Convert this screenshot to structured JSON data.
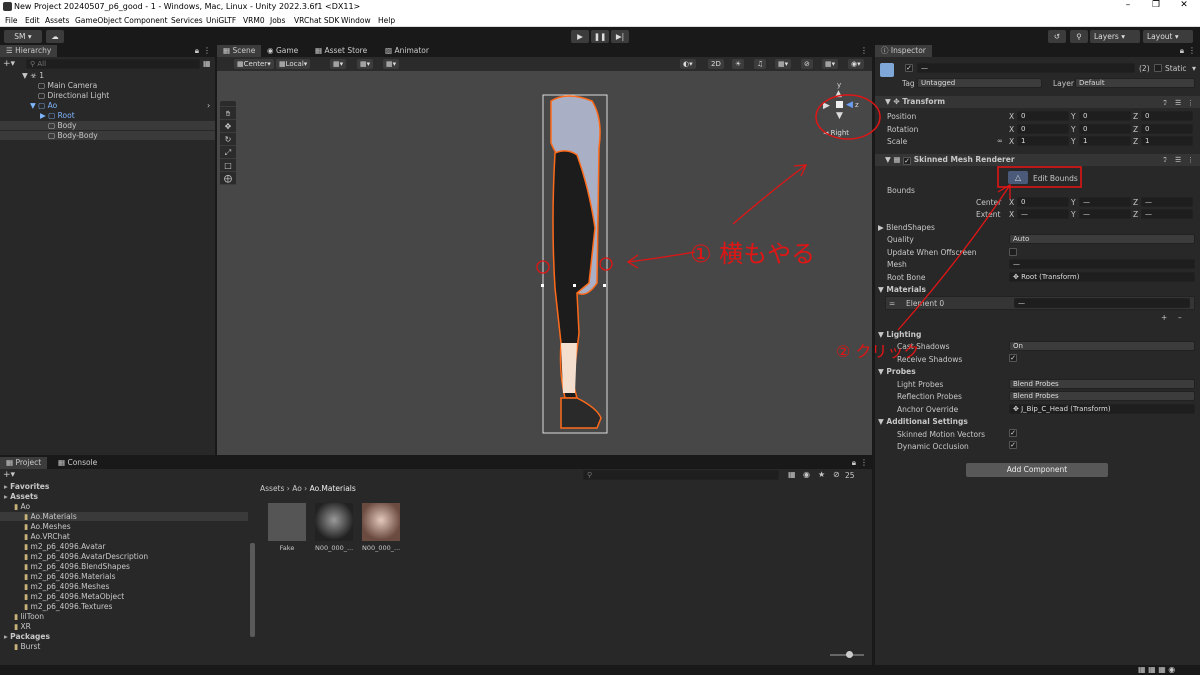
{
  "window": {
    "title": "New Project 20240507_p6_good - 1 - Windows, Mac, Linux - Unity 2022.3.6f1 <DX11>"
  },
  "menu": [
    "File",
    "Edit",
    "Assets",
    "GameObject",
    "Component",
    "Services",
    "UniGLTF",
    "VRM0",
    "Jobs",
    "VRChat SDK",
    "Window",
    "Help"
  ],
  "toolbar": {
    "account": "SM",
    "layers": "Layers",
    "layout": "Layout"
  },
  "hierarchy": {
    "tab": "Hierarchy",
    "search_placeholder": "All",
    "items": [
      "1",
      "Main Camera",
      "Directional Light",
      "Ao",
      "Root",
      "Body",
      "Body-Body"
    ]
  },
  "scene": {
    "tabs": [
      "Scene",
      "Game",
      "Asset Store",
      "Animator"
    ],
    "pivot": "Center",
    "space": "Local",
    "mode2d": "2D",
    "gizmo_label": "Right",
    "axis_y": "y",
    "axis_z": "z"
  },
  "annotations": {
    "note1": "① 横もやる",
    "note2": "② クリック"
  },
  "inspector": {
    "tab": "Inspector",
    "object_count": "(2)",
    "static_label": "Static",
    "tag_label": "Tag",
    "tag_value": "Untagged",
    "layer_label": "Layer",
    "layer_value": "Default",
    "transform": {
      "title": "Transform",
      "position": "Position",
      "rotation": "Rotation",
      "scale": "Scale",
      "pos": [
        "0",
        "0",
        "0"
      ],
      "rot": [
        "0",
        "0",
        "0"
      ],
      "scl": [
        "1",
        "1",
        "1"
      ]
    },
    "smr": {
      "title": "Skinned Mesh Renderer",
      "edit_bounds": "Edit Bounds",
      "bounds": "Bounds",
      "center": "Center",
      "extent": "Extent",
      "center_vals": [
        "0",
        "—",
        "—"
      ],
      "extent_vals": [
        "—",
        "—",
        "—"
      ],
      "blendshapes": "BlendShapes",
      "quality": "Quality",
      "quality_value": "Auto",
      "update_offscreen": "Update When Offscreen",
      "mesh": "Mesh",
      "mesh_value": "—",
      "root_bone": "Root Bone",
      "root_bone_value": "Root (Transform)",
      "materials": "Materials",
      "element0": "Element 0",
      "element0_value": "—",
      "lighting": "Lighting",
      "cast_shadows": "Cast Shadows",
      "cast_shadows_value": "On",
      "receive_shadows": "Receive Shadows",
      "probes": "Probes",
      "light_probes": "Light Probes",
      "light_probes_value": "Blend Probes",
      "reflection_probes": "Reflection Probes",
      "reflection_probes_value": "Blend Probes",
      "anchor_override": "Anchor Override",
      "anchor_override_value": "J_Bip_C_Head (Transform)",
      "additional": "Additional Settings",
      "motion_vectors": "Skinned Motion Vectors",
      "dynamic_occlusion": "Dynamic Occlusion"
    },
    "add_component": "Add Component"
  },
  "project": {
    "tabs": [
      "Project",
      "Console"
    ],
    "count": "25",
    "breadcrumb": [
      "Assets",
      "Ao",
      "Ao.Materials"
    ],
    "tree": [
      {
        "label": "Favorites",
        "bold": true,
        "indent": 0
      },
      {
        "label": "Assets",
        "bold": true,
        "indent": 0
      },
      {
        "label": "Ao",
        "indent": 1
      },
      {
        "label": "Ao.Materials",
        "indent": 2,
        "selected": true
      },
      {
        "label": "Ao.Meshes",
        "indent": 2
      },
      {
        "label": "Ao.VRChat",
        "indent": 2
      },
      {
        "label": "m2_p6_4096.Avatar",
        "indent": 2
      },
      {
        "label": "m2_p6_4096.AvatarDescription",
        "indent": 2
      },
      {
        "label": "m2_p6_4096.BlendShapes",
        "indent": 2
      },
      {
        "label": "m2_p6_4096.Materials",
        "indent": 2
      },
      {
        "label": "m2_p6_4096.Meshes",
        "indent": 2
      },
      {
        "label": "m2_p6_4096.MetaObject",
        "indent": 2
      },
      {
        "label": "m2_p6_4096.Textures",
        "indent": 2
      },
      {
        "label": "lilToon",
        "indent": 1
      },
      {
        "label": "XR",
        "indent": 1
      },
      {
        "label": "Packages",
        "bold": true,
        "indent": 0
      },
      {
        "label": "Burst",
        "indent": 1
      }
    ],
    "assets": [
      "Fake",
      "N00_000_...",
      "N00_000_..."
    ]
  }
}
